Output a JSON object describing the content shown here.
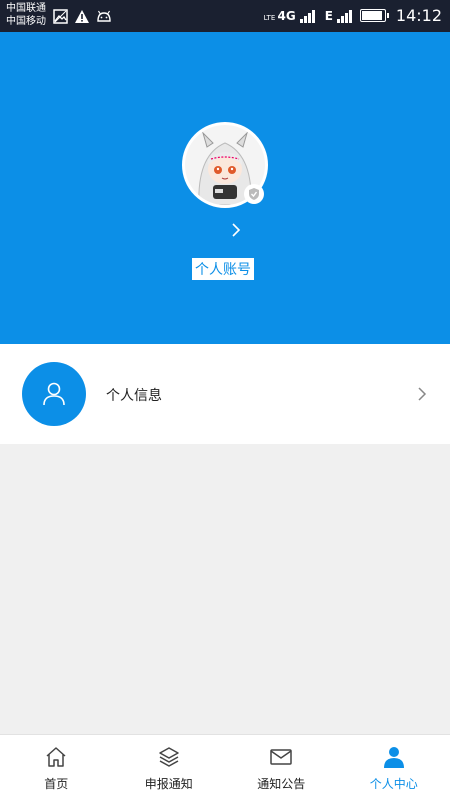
{
  "status_bar": {
    "carrier_1": "中国联通",
    "carrier_2": "中国移动",
    "net_1": "4G",
    "net_2": "E",
    "time": "14:12",
    "icons_left": [
      "image-icon",
      "warning-icon",
      "android-icon"
    ],
    "battery_level": 0.85
  },
  "profile": {
    "account_label": "个人账号"
  },
  "info_row": {
    "label": "个人信息"
  },
  "bottom_nav": {
    "items": [
      {
        "label": "首页",
        "icon": "home-icon",
        "active": false
      },
      {
        "label": "申报通知",
        "icon": "layers-icon",
        "active": false
      },
      {
        "label": "通知公告",
        "icon": "mail-icon",
        "active": false
      },
      {
        "label": "个人中心",
        "icon": "person-icon",
        "active": true
      }
    ]
  },
  "colors": {
    "accent": "#0c8fe7",
    "status_bar": "#1a2030",
    "background": "#f0f0f0"
  }
}
